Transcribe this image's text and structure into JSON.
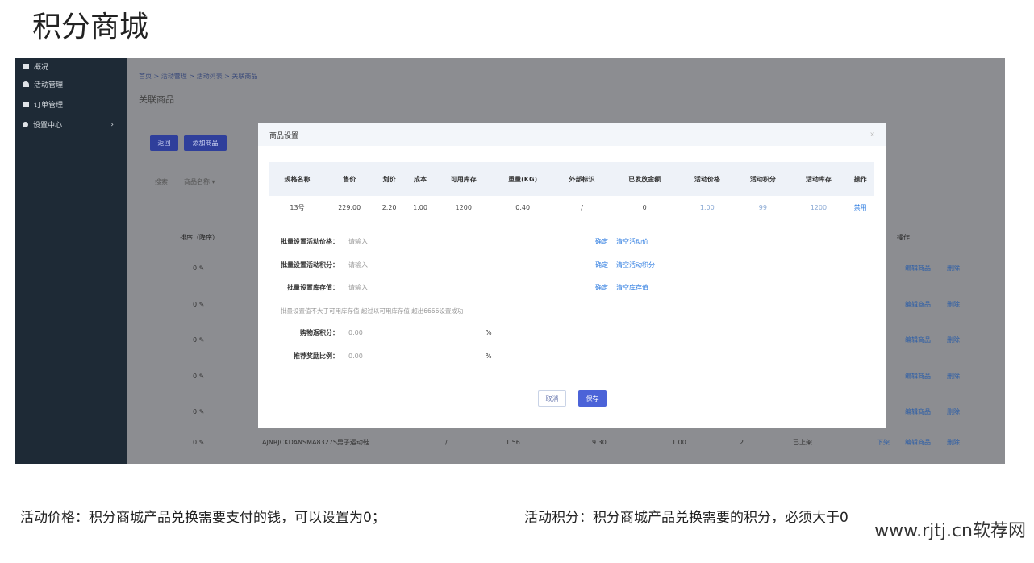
{
  "page_title": "积分商城",
  "sidebar": {
    "items": [
      {
        "label": "概况"
      },
      {
        "label": "活动管理"
      },
      {
        "label": "订单管理"
      },
      {
        "label": "设置中心"
      }
    ]
  },
  "breadcrumb": "首页 > 活动管理 > 活动列表 > 关联商品",
  "main": {
    "title": "关联商品",
    "back_label": "返回",
    "add_label": "添加商品",
    "search_label": "搜索",
    "search_field": "商品名称 ▾",
    "sort_header": "排序（降序）",
    "ops_header": "操作",
    "edit_label": "编辑商品",
    "delete_label": "删除",
    "rows": [
      {
        "sort": "0"
      },
      {
        "sort": "0"
      },
      {
        "sort": "0"
      },
      {
        "sort": "0"
      },
      {
        "sort": "0"
      },
      {
        "sort": "0",
        "name": "AJNRJCKDANSMA8327S男子运动鞋",
        "c1": "/",
        "c2": "1.56",
        "c3": "9.30",
        "c4": "1.00",
        "c5": "2",
        "status": "已上架",
        "toggle": "下架"
      }
    ]
  },
  "modal": {
    "title": "商品设置",
    "close": "×",
    "headers": [
      "规格名称",
      "售价",
      "划价",
      "成本",
      "可用库存",
      "重量(KG)",
      "外部标识",
      "已发放金额",
      "活动价格",
      "活动积分",
      "活动库存",
      "操作"
    ],
    "row": [
      "13号",
      "229.00",
      "2.20",
      "1.00",
      "1200",
      "0.40",
      "/",
      "0",
      "1.00",
      "99",
      "1200",
      "禁用"
    ],
    "batch": [
      {
        "label": "批量设置活动价格：",
        "placeholder": "请输入",
        "confirm": "确定",
        "clear": "清空活动价"
      },
      {
        "label": "批量设置活动积分：",
        "placeholder": "请输入",
        "confirm": "确定",
        "clear": "清空活动积分"
      },
      {
        "label": "批量设置库存值：",
        "placeholder": "请输入",
        "confirm": "确定",
        "clear": "清空库存值"
      }
    ],
    "hint": "批量设置值不大于可用库存值    超过以可用库存值    超出6666设置成功",
    "rebate": {
      "label": "购物返积分：",
      "value": "0.00",
      "unit": "%"
    },
    "reward": {
      "label": "推荐奖励比例：",
      "value": "0.00",
      "unit": "%"
    },
    "cancel": "取消",
    "save": "保存"
  },
  "captions": {
    "left": "活动价格：积分商城产品兑换需要支付的钱，可以设置为0；",
    "right": "活动积分：积分商城产品兑换需要的积分，必须大于0"
  },
  "watermark": "www.rjtj.cn软荐网"
}
